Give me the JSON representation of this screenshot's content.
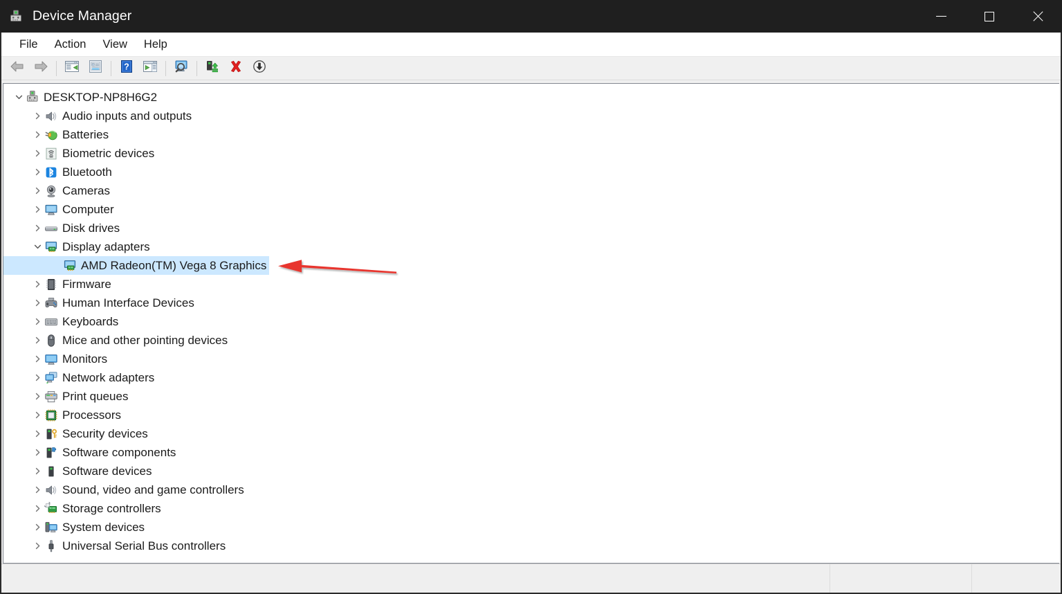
{
  "window": {
    "title": "Device Manager",
    "app_icon": "device-manager-icon",
    "controls": {
      "minimize": "Minimize",
      "maximize": "Maximize",
      "close": "Close"
    }
  },
  "menubar": {
    "items": [
      {
        "label": "File"
      },
      {
        "label": "Action"
      },
      {
        "label": "View"
      },
      {
        "label": "Help"
      }
    ]
  },
  "toolbar": {
    "buttons": [
      {
        "name": "back-button",
        "icon": "back-arrow-icon",
        "tooltip": "Back"
      },
      {
        "name": "forward-button",
        "icon": "forward-arrow-icon",
        "tooltip": "Forward"
      },
      {
        "name": "show-hide-console-tree",
        "icon": "console-tree-icon",
        "tooltip": "Show/Hide Console Tree"
      },
      {
        "name": "properties-button",
        "icon": "properties-icon",
        "tooltip": "Properties"
      },
      {
        "name": "help-button",
        "icon": "help-question-icon",
        "tooltip": "Help"
      },
      {
        "name": "show-hide-action-pane",
        "icon": "action-pane-icon",
        "tooltip": "Show/Hide Action Pane"
      },
      {
        "name": "scan-hardware-changes",
        "icon": "scan-monitor-icon",
        "tooltip": "Scan for hardware changes"
      },
      {
        "name": "update-driver-button",
        "icon": "update-driver-icon",
        "tooltip": "Update driver"
      },
      {
        "name": "uninstall-device-button",
        "icon": "red-x-icon",
        "tooltip": "Uninstall device"
      },
      {
        "name": "disable-device-button",
        "icon": "disable-down-arrow-icon",
        "tooltip": "Disable device"
      }
    ]
  },
  "tree": {
    "root": {
      "label": "DESKTOP-NP8H6G2",
      "icon": "computer-root-icon",
      "expanded": true
    },
    "nodes": [
      {
        "label": "Audio inputs and outputs",
        "icon": "speaker-icon",
        "expanded": false,
        "level": 1,
        "selected": false
      },
      {
        "label": "Batteries",
        "icon": "battery-plug-icon",
        "expanded": false,
        "level": 1,
        "selected": false
      },
      {
        "label": "Biometric devices",
        "icon": "fingerprint-icon",
        "expanded": false,
        "level": 1,
        "selected": false
      },
      {
        "label": "Bluetooth",
        "icon": "bluetooth-icon",
        "expanded": false,
        "level": 1,
        "selected": false
      },
      {
        "label": "Cameras",
        "icon": "camera-icon",
        "expanded": false,
        "level": 1,
        "selected": false
      },
      {
        "label": "Computer",
        "icon": "monitor-icon",
        "expanded": false,
        "level": 1,
        "selected": false
      },
      {
        "label": "Disk drives",
        "icon": "disk-drive-icon",
        "expanded": false,
        "level": 1,
        "selected": false
      },
      {
        "label": "Display adapters",
        "icon": "display-adapter-icon",
        "expanded": true,
        "level": 1,
        "selected": false
      },
      {
        "label": "AMD Radeon(TM) Vega 8 Graphics",
        "icon": "display-adapter-icon",
        "expanded": null,
        "level": 2,
        "selected": true
      },
      {
        "label": "Firmware",
        "icon": "firmware-chip-icon",
        "expanded": false,
        "level": 1,
        "selected": false
      },
      {
        "label": "Human Interface Devices",
        "icon": "hid-gamepad-icon",
        "expanded": false,
        "level": 1,
        "selected": false
      },
      {
        "label": "Keyboards",
        "icon": "keyboard-icon",
        "expanded": false,
        "level": 1,
        "selected": false
      },
      {
        "label": "Mice and other pointing devices",
        "icon": "mouse-icon",
        "expanded": false,
        "level": 1,
        "selected": false
      },
      {
        "label": "Monitors",
        "icon": "monitor-blue-icon",
        "expanded": false,
        "level": 1,
        "selected": false
      },
      {
        "label": "Network adapters",
        "icon": "network-adapter-icon",
        "expanded": false,
        "level": 1,
        "selected": false
      },
      {
        "label": "Print queues",
        "icon": "printer-icon",
        "expanded": false,
        "level": 1,
        "selected": false
      },
      {
        "label": "Processors",
        "icon": "processor-chip-icon",
        "expanded": false,
        "level": 1,
        "selected": false
      },
      {
        "label": "Security devices",
        "icon": "security-key-icon",
        "expanded": false,
        "level": 1,
        "selected": false
      },
      {
        "label": "Software components",
        "icon": "software-puzzle-icon",
        "expanded": false,
        "level": 1,
        "selected": false
      },
      {
        "label": "Software devices",
        "icon": "software-device-icon",
        "expanded": false,
        "level": 1,
        "selected": false
      },
      {
        "label": "Sound, video and game controllers",
        "icon": "speaker-icon",
        "expanded": false,
        "level": 1,
        "selected": false
      },
      {
        "label": "Storage controllers",
        "icon": "storage-controller-icon",
        "expanded": false,
        "level": 1,
        "selected": false
      },
      {
        "label": "System devices",
        "icon": "system-device-icon",
        "expanded": false,
        "level": 1,
        "selected": false
      },
      {
        "label": "Universal Serial Bus controllers",
        "icon": "usb-icon",
        "expanded": false,
        "level": 1,
        "selected": false
      }
    ]
  },
  "annotation": {
    "arrow": {
      "name": "red-pointer-arrow",
      "color": "#e8352e",
      "points_to": "AMD Radeon(TM) Vega 8 Graphics"
    }
  },
  "statusbar": {
    "panes": [
      {
        "text": ""
      },
      {
        "text": ""
      },
      {
        "text": ""
      }
    ]
  },
  "colors": {
    "titlebar_bg": "#1f1f1f",
    "selection_bg": "#cce8ff",
    "toolbar_bg": "#f0f0f0",
    "accent_red": "#e8352e"
  }
}
